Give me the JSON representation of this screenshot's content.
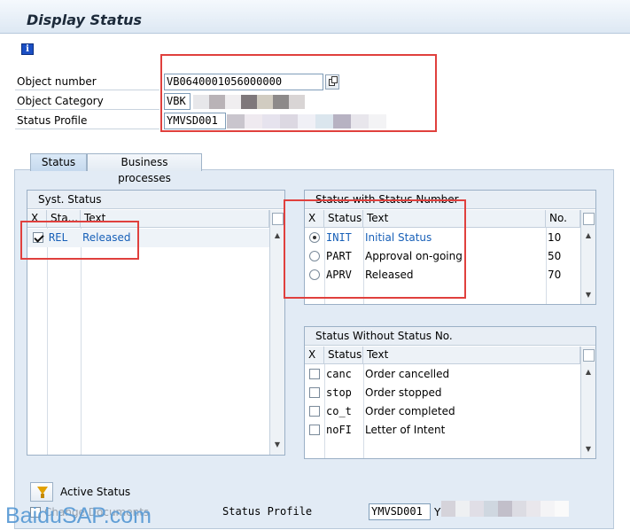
{
  "header": {
    "title": "Display Status",
    "info_icon": "i"
  },
  "fields": {
    "object_number_label": "Object number",
    "object_number_value": "VB0640001056000000",
    "object_category_label": "Object Category",
    "object_category_value": "VBK",
    "status_profile_label": "Status Profile",
    "status_profile_value": "YMVSD001"
  },
  "tabs": [
    {
      "label": "Status"
    },
    {
      "label": "Business processes"
    }
  ],
  "syst_status": {
    "title": "Syst. Status",
    "columns": [
      "X",
      "Sta...",
      "Text"
    ],
    "rows": [
      {
        "checked": true,
        "status": "REL",
        "text": "Released"
      }
    ]
  },
  "status_with_number": {
    "title": "Status with Status Number",
    "columns": [
      "X",
      "Status",
      "Text",
      "No."
    ],
    "rows": [
      {
        "selected": true,
        "status": "INIT",
        "text": "Initial Status",
        "no": "10"
      },
      {
        "selected": false,
        "status": "PART",
        "text": "Approval on-going",
        "no": "50"
      },
      {
        "selected": false,
        "status": "APRV",
        "text": "Released",
        "no": "70"
      }
    ]
  },
  "status_without_number": {
    "title": "Status Without Status No.",
    "columns": [
      "X",
      "Status",
      "Text"
    ],
    "rows": [
      {
        "checked": false,
        "status": "canc",
        "text": "Order cancelled"
      },
      {
        "checked": false,
        "status": "stop",
        "text": "Order stopped"
      },
      {
        "checked": false,
        "status": "co_t",
        "text": "Order completed"
      },
      {
        "checked": false,
        "status": "noFI",
        "text": "Letter of Intent"
      }
    ]
  },
  "footer": {
    "active_status_label": "Active Status",
    "change_documents_label": "Change Documents",
    "status_profile_label": "Status Profile",
    "status_profile_value": "YMVSD001",
    "trailing_char": "Y"
  },
  "watermark": "BaiduSAP.com",
  "colors": {
    "accent_red": "#e0403d",
    "link_blue": "#1860b8",
    "watermark": "#5b9bd5"
  }
}
